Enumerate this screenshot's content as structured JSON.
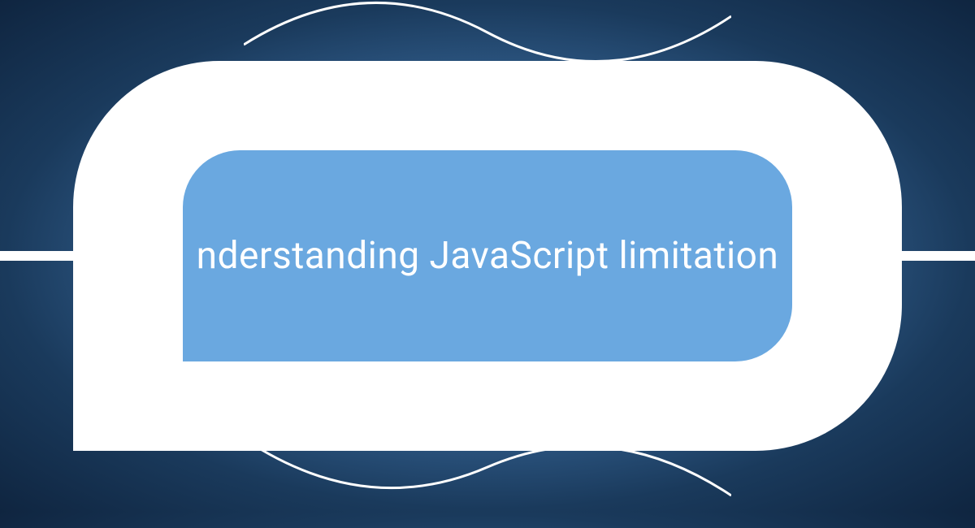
{
  "card": {
    "title": "nderstanding JavaScript limitation",
    "colors": {
      "inner_fill": "#6aa8e0",
      "outer_fill": "#ffffff",
      "bg_dark": "#0f2540",
      "bg_light": "#5a9ce0"
    }
  }
}
